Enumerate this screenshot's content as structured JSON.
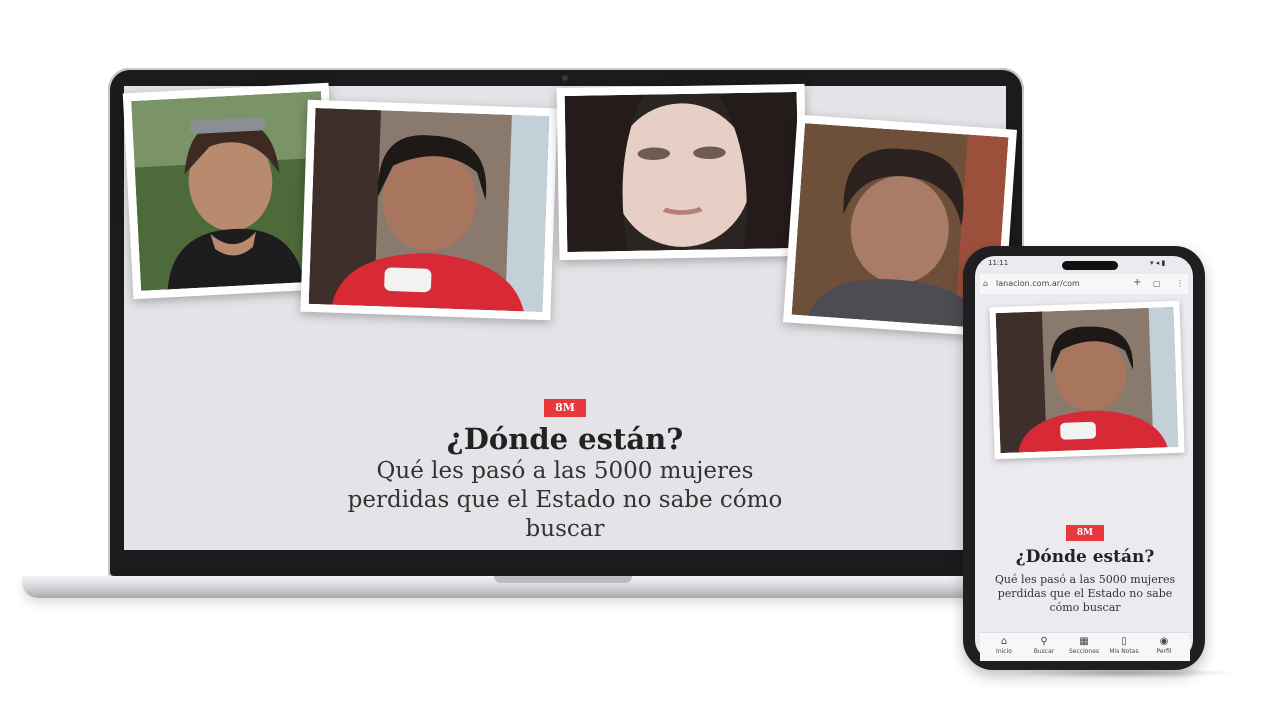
{
  "laptop": {
    "badge": "8M",
    "title": "¿Dónde están?",
    "subtitle": "Qué les pasó a las 5000 mujeres perdidas que el Estado no sabe cómo buscar"
  },
  "phone": {
    "status": {
      "time": "11:11",
      "icons": "▾ ◂ ▮"
    },
    "url": "lanacion.com.ar/com",
    "badge": "8M",
    "title": "¿Dónde están?",
    "subtitle": "Qué les pasó a las 5000 mujeres perdidas que el Estado no sabe cómo buscar",
    "nav": [
      {
        "label": "Inicio",
        "icon": "home-icon"
      },
      {
        "label": "Buscar",
        "icon": "search-icon"
      },
      {
        "label": "Secciones",
        "icon": "grid-icon"
      },
      {
        "label": "Mis Notas",
        "icon": "bookmark-icon"
      },
      {
        "label": "Perfil",
        "icon": "profile-icon"
      }
    ]
  },
  "colors": {
    "accent": "#e8383b",
    "screen_bg": "#e4e3e7",
    "device": "#1b1b1d"
  }
}
